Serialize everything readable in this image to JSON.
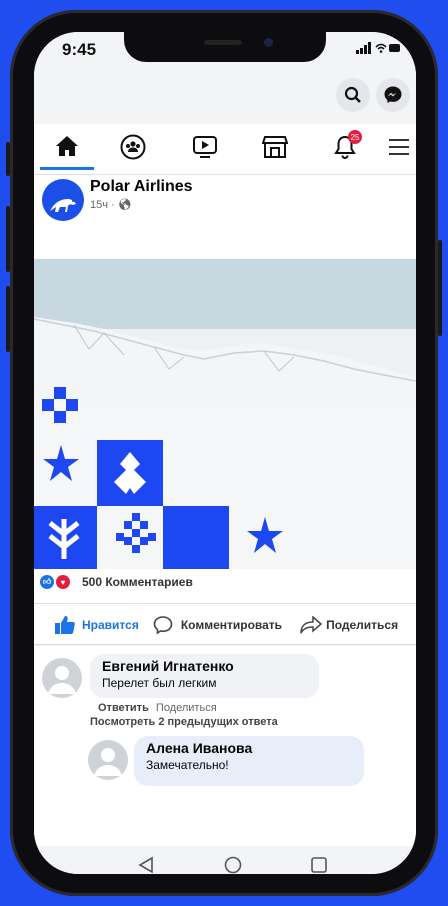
{
  "status": {
    "time": "9:45",
    "signal": "▮▮▮ ◠ ▬"
  },
  "top_icons": {
    "search": "search-icon",
    "messenger": "messenger-icon"
  },
  "nav": {
    "items": [
      "home-icon",
      "groups-icon",
      "video-icon",
      "marketplace-icon",
      "notifications-icon",
      "menu-icon"
    ],
    "notif_badge": "25",
    "accent": "#1b74e4"
  },
  "post": {
    "author": "Polar Airlines",
    "meta": "15ч · ",
    "reactions_count": "500 Комментариев",
    "actions": {
      "like": "Нравится",
      "comment": "Комментировать",
      "share": "Поделиться"
    }
  },
  "comments": [
    {
      "name": "Евгений Игнатенко",
      "text": "Перелет был легким",
      "reply_label": "Ответить",
      "share_label": "Поделиться"
    },
    {
      "name": "Алена Иванова",
      "text": "Замечательно!"
    }
  ],
  "view_more": "Посмотреть 2 предыдущих ответа",
  "colors": {
    "brand": "#1b4fe8",
    "background": "#1f4df0"
  }
}
